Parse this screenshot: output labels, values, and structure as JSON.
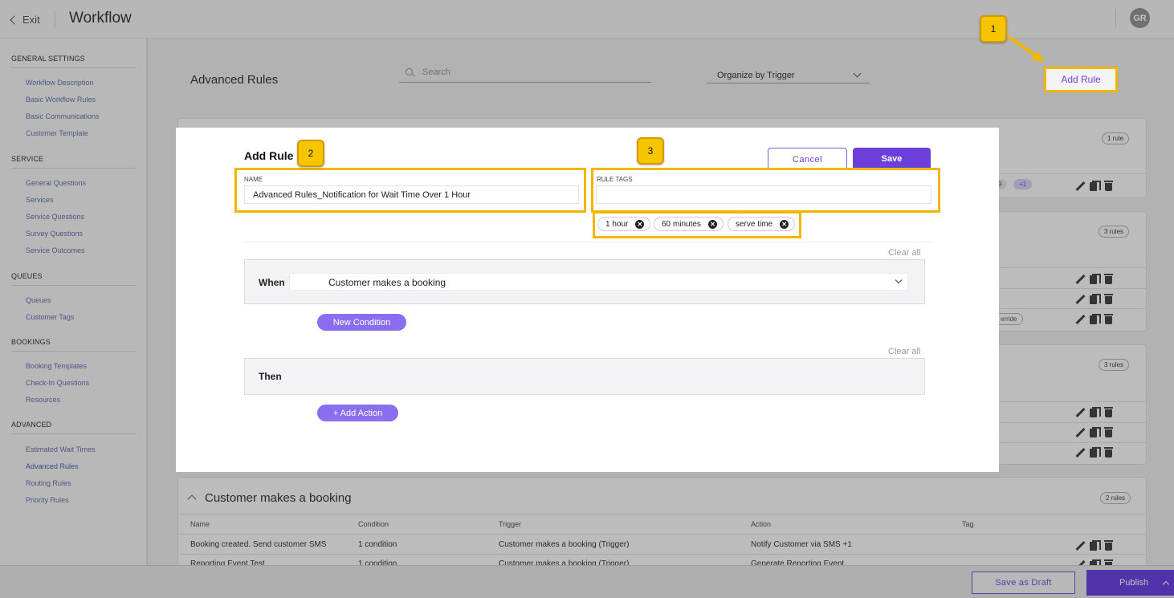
{
  "header": {
    "exit_label": "Exit",
    "title": "Workflow",
    "avatar_initials": "GR"
  },
  "sidebar": {
    "sections": [
      {
        "title": "GENERAL SETTINGS",
        "items": [
          "Workflow Description",
          "Basic Workflow Rules",
          "Basic Communications",
          "Customer Template"
        ]
      },
      {
        "title": "SERVICE",
        "items": [
          "General Questions",
          "Services",
          "Service Questions",
          "Survey Questions",
          "Service Outcomes"
        ]
      },
      {
        "title": "QUEUES",
        "items": [
          "Queues",
          "Customer Tags"
        ]
      },
      {
        "title": "BOOKINGS",
        "items": [
          "Booking Templates",
          "Check-In Questions",
          "Resources"
        ]
      },
      {
        "title": "ADVANCED",
        "items": [
          "Estimated Wait Times",
          "Advanced Rules",
          "Routing Rules",
          "Priority Rules"
        ]
      }
    ]
  },
  "main": {
    "title": "Advanced Rules",
    "search_placeholder": "Search",
    "organize_label": "Organize by Trigger",
    "add_rule_label": "Add Rule",
    "cards": [
      {
        "count": "1 rule",
        "tag_fragments": [
          "9",
          "+1"
        ]
      },
      {
        "count": "3 rules",
        "tag_fragments": [
          "erride"
        ]
      },
      {
        "count": "3 rules"
      }
    ],
    "booking_group": {
      "title": "Customer makes a booking",
      "count": "2 rules",
      "columns": [
        "Name",
        "Condition",
        "Trigger",
        "Action",
        "Tag"
      ],
      "rows": [
        [
          "Booking created. Send customer SMS",
          "1 condition",
          "Customer makes a booking (Trigger)",
          "Notify Customer via SMS +1",
          ""
        ],
        [
          "Reporting Event Test",
          "1 condition",
          "Customer makes a booking (Trigger)",
          "Generate Reporting Event",
          ""
        ]
      ]
    }
  },
  "footer": {
    "save_draft_label": "Save as Draft",
    "publish_label": "Publish"
  },
  "modal": {
    "title": "Add Rule",
    "cancel_label": "Cancel",
    "save_label": "Save",
    "name_label": "NAME",
    "name_value": "Advanced Rules_Notification for Wait Time Over 1 Hour",
    "tags_label": "RULE TAGS",
    "tags": [
      "1 hour",
      "60 minutes",
      "serve time"
    ],
    "clear_all_label": "Clear all",
    "when_label": "When",
    "when_value": "Customer makes a booking",
    "new_condition_label": "New Condition",
    "then_label": "Then",
    "add_action_label": "+ Add Action"
  },
  "callouts": [
    "1",
    "2",
    "3"
  ],
  "colors": {
    "accent": "#6b3fd9",
    "highlight": "#f2b500",
    "callout": "#f7c400"
  }
}
